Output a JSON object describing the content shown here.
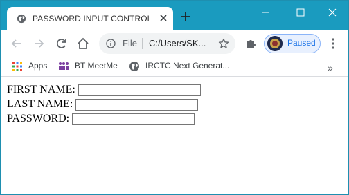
{
  "browser": {
    "tab_title": "PASSWORD INPUT CONTROL",
    "omnibox": {
      "scheme": "File",
      "url": "C:/Users/SK..."
    },
    "profile_status": "Paused",
    "bookmarks": [
      {
        "label": "Apps",
        "icon": "apps-grid-icon"
      },
      {
        "label": "BT MeetMe",
        "icon": "meetme-icon"
      },
      {
        "label": "IRCTC Next Generat...",
        "icon": "globe-icon"
      }
    ],
    "more_bookmarks": "»"
  },
  "form": {
    "fields": [
      {
        "label": "FIRST NAME:",
        "type": "text",
        "value": ""
      },
      {
        "label": "LAST NAME:",
        "type": "text",
        "value": ""
      },
      {
        "label": "PASSWORD:",
        "type": "password",
        "value": ""
      }
    ]
  },
  "colors": {
    "title_bar": "#1a9bbf",
    "omnibox_bg": "#f1f3f4",
    "profile_accent": "#1a73e8"
  }
}
